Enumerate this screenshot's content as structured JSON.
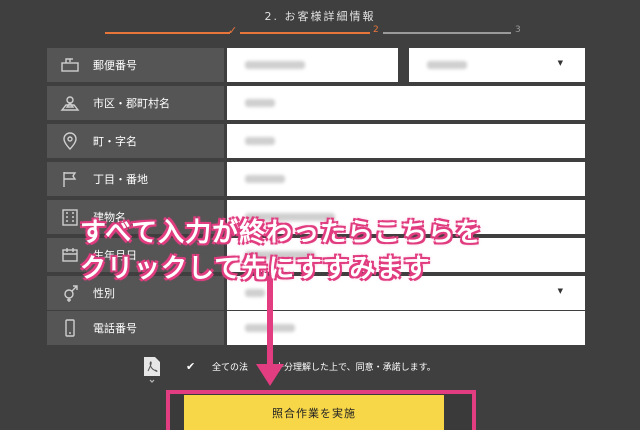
{
  "header": {
    "step_title": "2. お客様詳細情報",
    "steps": [
      {
        "number": "2",
        "state": "current"
      },
      {
        "number": "3",
        "state": "upcoming"
      }
    ],
    "completed_mark": "✓"
  },
  "form": {
    "rows": [
      {
        "label": "郵便番号",
        "icon": "mailbox-icon"
      },
      {
        "label": "市区・郡町村名",
        "icon": "map-icon"
      },
      {
        "label": "町・字名",
        "icon": "location-pin-icon"
      },
      {
        "label": "丁目・番地",
        "icon": "flag-icon"
      },
      {
        "label": "建物名",
        "icon": "building-icon"
      },
      {
        "label": "生年月日",
        "icon": "calendar-icon"
      },
      {
        "label": "性別",
        "icon": "gender-icon"
      },
      {
        "label": "電話番号",
        "icon": "phone-icon"
      }
    ]
  },
  "agreement": {
    "text": "全ての法　　を十分理解した上で、同意・承諾します。",
    "checked": true
  },
  "submit": {
    "label": "照合作業を実施"
  },
  "annotation": {
    "line1": "すべて入力が終わったらこちらを",
    "line2": "クリックして先にすすみます",
    "color": "#e13d80"
  },
  "colors": {
    "accent": "#e8753a",
    "button": "#f7d748",
    "highlight": "#e13d80"
  }
}
